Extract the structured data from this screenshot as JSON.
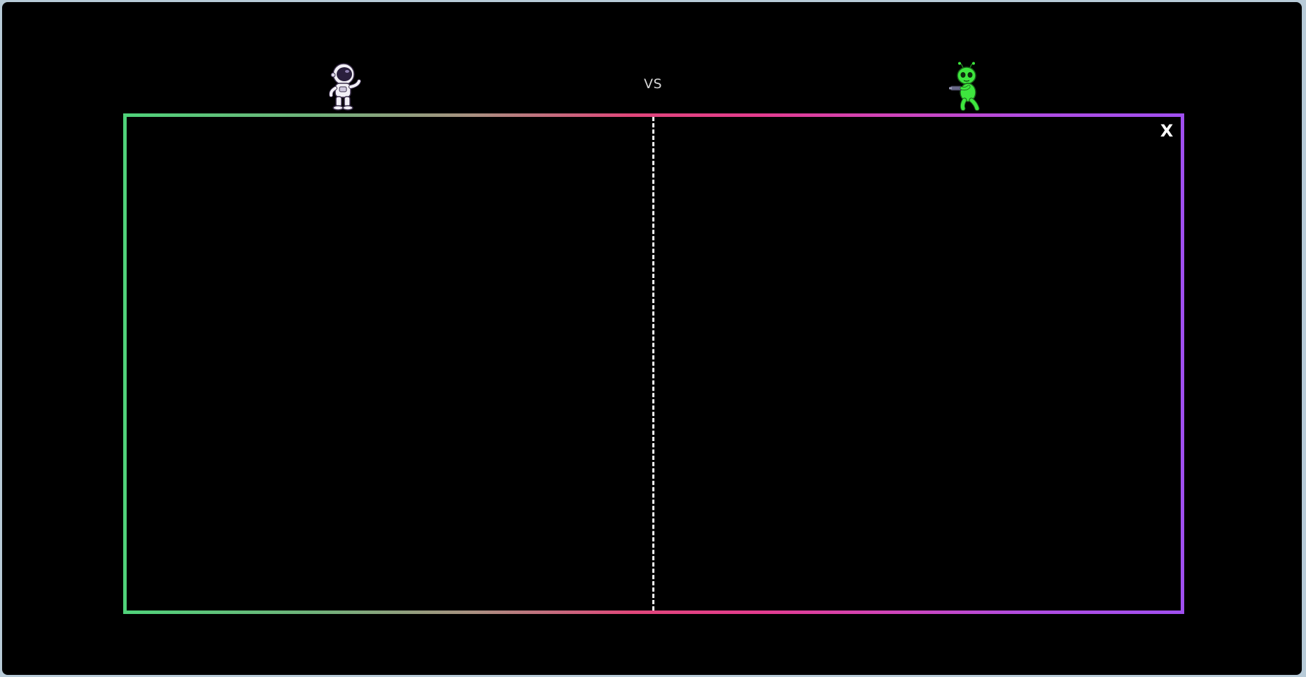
{
  "header": {
    "vs_text": "VS"
  },
  "players": [
    {
      "name": "astronaut",
      "icon": "astronaut-icon"
    },
    {
      "name": "alien",
      "icon": "alien-icon"
    }
  ],
  "arena": {
    "close_label": "X",
    "border_gradient": [
      "#4fd27a",
      "#e0467a",
      "#a04ff0"
    ],
    "center_line_color": "#ffffff"
  }
}
